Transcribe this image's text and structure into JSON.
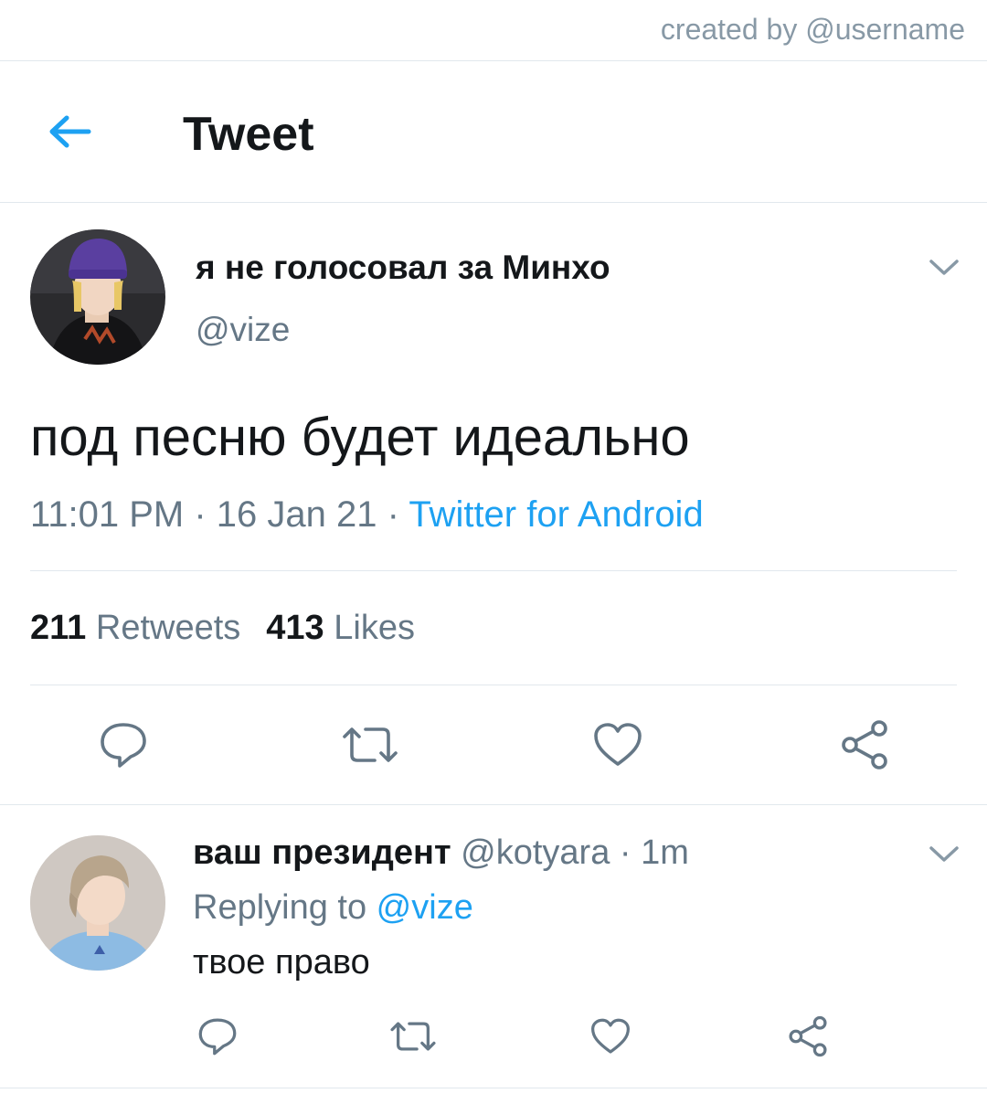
{
  "credit": "created by @username",
  "header": {
    "title": "Tweet"
  },
  "tweet": {
    "display_name": "я не голосовал за Минхо",
    "handle": "@vize",
    "text": "под песню будет идеально",
    "time": "11:01 PM",
    "date": "16 Jan 21",
    "separator": " · ",
    "source": "Twitter for Android",
    "retweets_count": "211",
    "retweets_label": "Retweets",
    "likes_count": "413",
    "likes_label": "Likes"
  },
  "reply": {
    "display_name": "ваш президент",
    "handle": "@kotyara",
    "separator": " · ",
    "age": "1m",
    "replying_label": "Replying to ",
    "replying_mention": "@vize",
    "text": "твое право"
  },
  "colors": {
    "accent": "#1da1f2",
    "muted": "#657786",
    "text": "#14171a",
    "divider": "#e1e8ed"
  },
  "icons": [
    "back-arrow-icon",
    "chevron-down-icon",
    "reply-icon",
    "retweet-icon",
    "like-icon",
    "share-icon"
  ]
}
